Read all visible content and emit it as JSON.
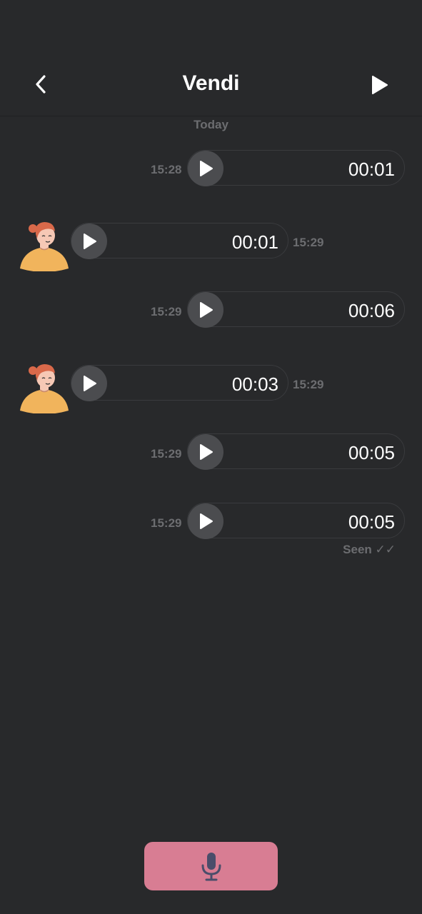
{
  "header": {
    "title": "Vendi",
    "back_icon": "chevron-left-icon",
    "play_icon": "play-icon"
  },
  "date_separator": "Today",
  "messages": [
    {
      "side": "sent",
      "time": "15:28",
      "duration": "00:01"
    },
    {
      "side": "received",
      "time": "15:29",
      "duration": "00:01"
    },
    {
      "side": "sent",
      "time": "15:29",
      "duration": "00:06"
    },
    {
      "side": "received",
      "time": "15:29",
      "duration": "00:03"
    },
    {
      "side": "sent",
      "time": "15:29",
      "duration": "00:05"
    },
    {
      "side": "sent",
      "time": "15:29",
      "duration": "00:05"
    }
  ],
  "seen_label": "Seen ✓✓",
  "record_button": {
    "icon": "microphone-icon"
  },
  "colors": {
    "background": "#28292b",
    "bubble_border": "#3a3b3e",
    "play_circle": "#4b4c4f",
    "muted_text": "#6c6d70",
    "record_button": "#d87d93",
    "mic_icon": "#4a4d6a",
    "avatar_shirt": "#f1b45c",
    "avatar_hair": "#d9694a"
  }
}
